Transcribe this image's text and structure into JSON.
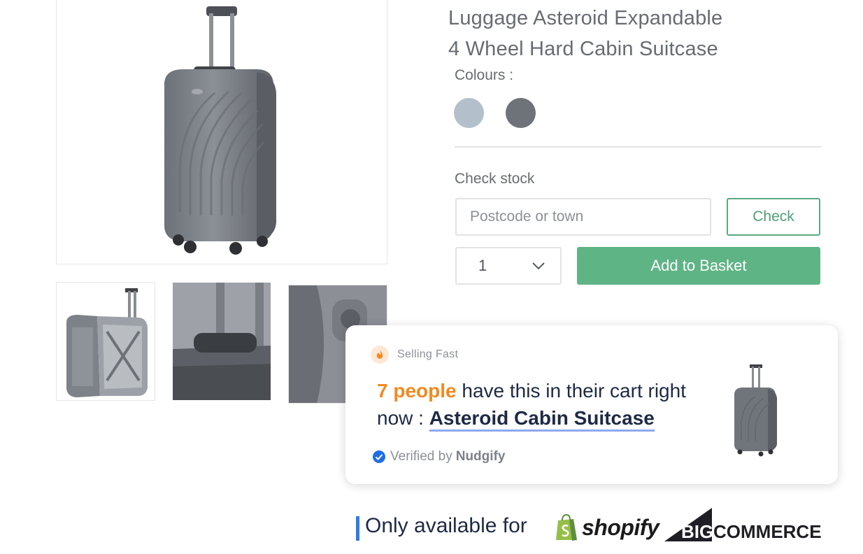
{
  "product": {
    "title_line1": "Luggage Asteroid Expandable",
    "title_line2": "4 Wheel Hard Cabin Suitcase",
    "colours_label": "Colours :",
    "colours": [
      {
        "name": "light-grey-blue",
        "hex": "#b3c0cc"
      },
      {
        "name": "dark-grey",
        "hex": "#6e737a"
      }
    ]
  },
  "stock": {
    "label": "Check stock",
    "placeholder": "Postcode or town",
    "check_button": "Check"
  },
  "purchase": {
    "quantity": "1",
    "add_button": "Add to Basket"
  },
  "nudge": {
    "tag": "Selling Fast",
    "count_text": "7 people",
    "message": " have this in their cart right now : ",
    "product_link": "Asteroid Cabin Suitcase",
    "verified_prefix": "Verified by",
    "verified_brand": "Nudgify"
  },
  "footer": {
    "text": "Only available for",
    "shopify": "shopify",
    "bigcommerce_big": "BIG",
    "bigcommerce_rest": "COMMERCE"
  },
  "colors": {
    "accent_green": "#5fb486",
    "nudge_orange": "#f28a1f",
    "link_underline": "#8fa8ee",
    "footer_bar": "#2f7be5"
  }
}
